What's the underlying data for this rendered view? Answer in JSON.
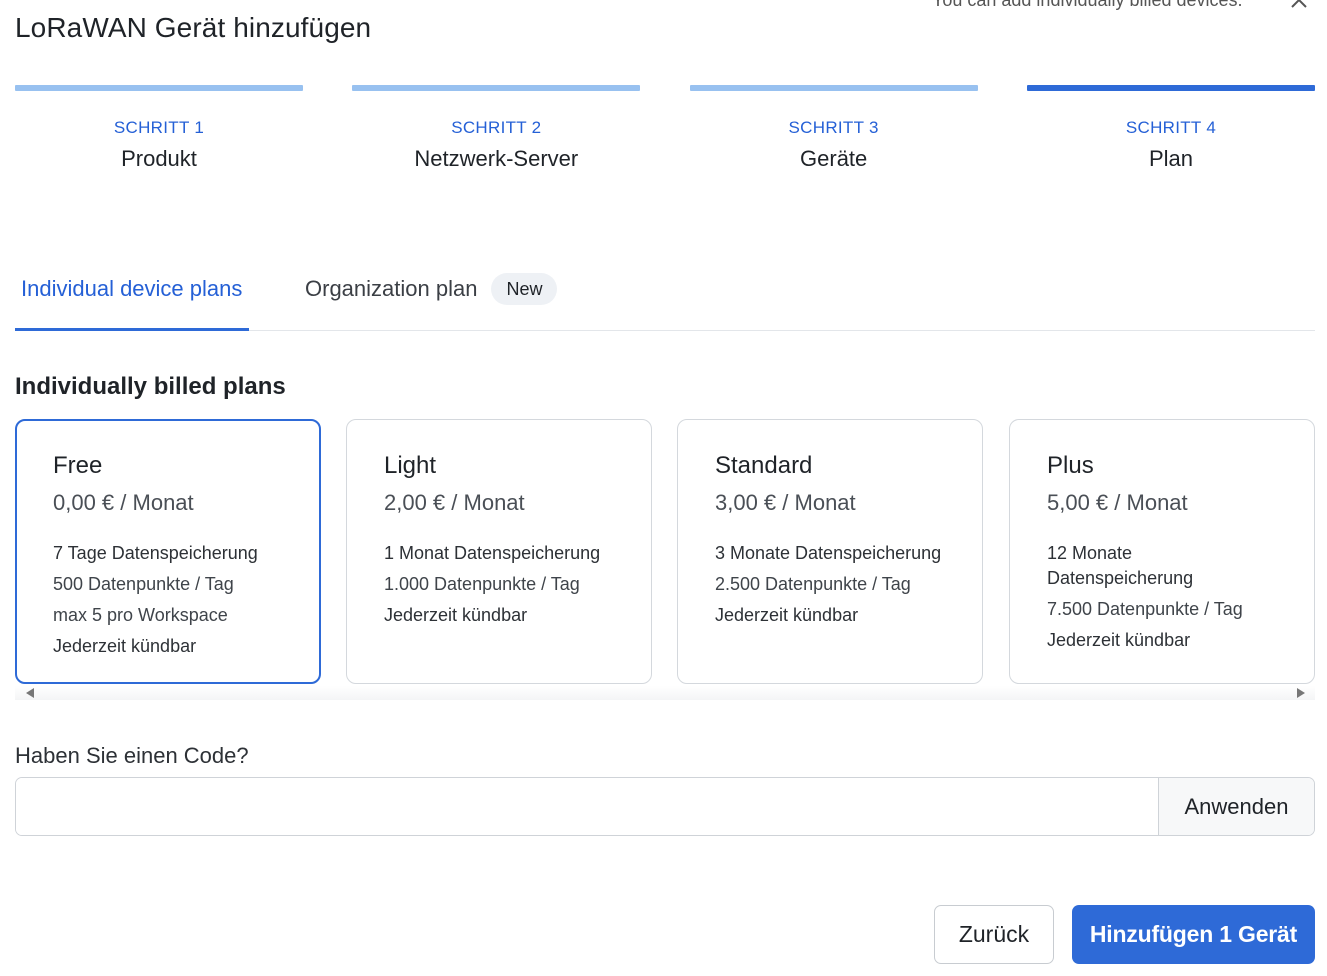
{
  "header": {
    "hint": "You can add individually billed devices.",
    "title": "LoRaWAN Gerät hinzufügen"
  },
  "steps": [
    {
      "label": "SCHRITT 1",
      "name": "Produkt"
    },
    {
      "label": "SCHRITT 2",
      "name": "Netzwerk-Server"
    },
    {
      "label": "SCHRITT 3",
      "name": "Geräte"
    },
    {
      "label": "SCHRITT 4",
      "name": "Plan"
    }
  ],
  "active_step": 4,
  "tabs": {
    "individual": "Individual device plans",
    "organization": "Organization plan",
    "organization_badge": "New"
  },
  "section_title": "Individually billed plans",
  "plans": [
    {
      "name": "Free",
      "price": "0,00 € / Monat",
      "features": [
        "7 Tage Datenspeicherung",
        "500 Datenpunkte / Tag",
        "max 5 pro Workspace",
        "Jederzeit kündbar"
      ],
      "selected": true
    },
    {
      "name": "Light",
      "price": "2,00 € / Monat",
      "features": [
        "1 Monat Datenspeicherung",
        "1.000 Datenpunkte / Tag",
        "Jederzeit kündbar"
      ],
      "selected": false
    },
    {
      "name": "Standard",
      "price": "3,00 € / Monat",
      "features": [
        "3 Monate Datenspeicherung",
        "2.500 Datenpunkte / Tag",
        "Jederzeit kündbar"
      ],
      "selected": false
    },
    {
      "name": "Plus",
      "price": "5,00 € / Monat",
      "features": [
        "12 Monate Datenspeicherung",
        "7.500 Datenpunkte / Tag",
        "Jederzeit kündbar"
      ],
      "selected": false
    }
  ],
  "code": {
    "label": "Haben Sie einen Code?",
    "value": "",
    "placeholder": "",
    "apply_label": "Anwenden"
  },
  "footer": {
    "back_label": "Zurück",
    "add_label": "Hinzufügen 1 Gerät"
  },
  "colors": {
    "accent": "#2e6ad7",
    "step_inactive": "#98c1f0",
    "step_label": "#2560d6"
  },
  "icons": {
    "close": "close-icon",
    "scroll_left": "scroll-left-arrow",
    "scroll_right": "scroll-right-arrow"
  }
}
